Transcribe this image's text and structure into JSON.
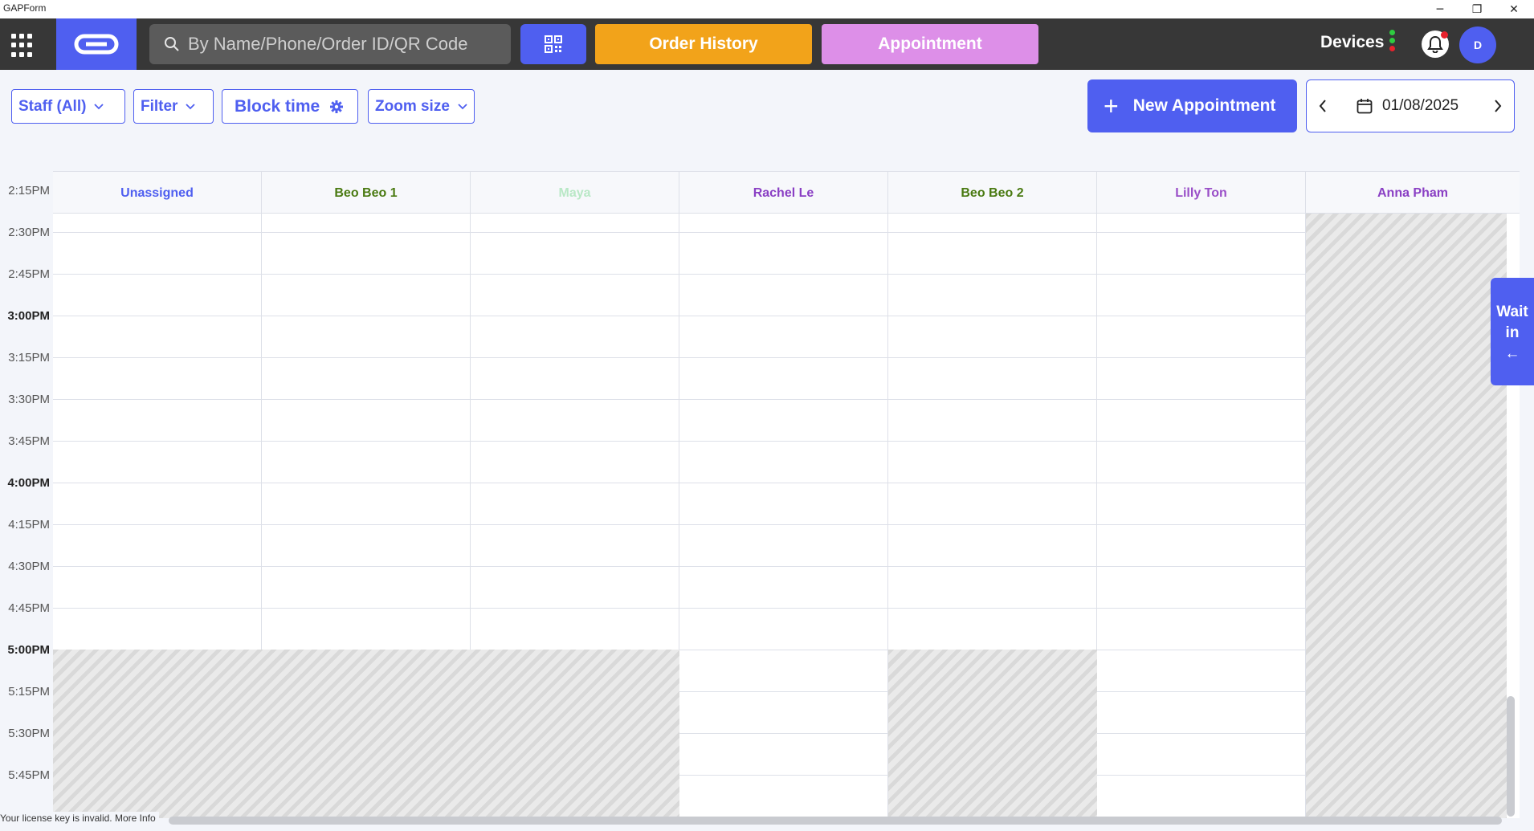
{
  "window": {
    "title": "GAPForm"
  },
  "topnav": {
    "search_placeholder": "By Name/Phone/Order ID/QR Code",
    "order_history_label": "Order History",
    "appointment_label": "Appointment",
    "devices_label": "Devices",
    "avatar_initial": "D",
    "colors": {
      "bar": "#373737",
      "brand": "#4f5ff0",
      "order": "#f2a31a",
      "appointment": "#dd8fe8"
    }
  },
  "toolbar": {
    "staff_label": "Staff (All)",
    "filter_label": "Filter",
    "block_time_label": "Block time",
    "zoom_label": "Zoom size",
    "new_appointment_label": "New Appointment",
    "date": "01/08/2025"
  },
  "calendar": {
    "times": [
      "2:15PM",
      "2:30PM",
      "2:45PM",
      "3:00PM",
      "3:15PM",
      "3:30PM",
      "3:45PM",
      "4:00PM",
      "4:15PM",
      "4:30PM",
      "4:45PM",
      "5:00PM",
      "5:15PM",
      "5:30PM",
      "5:45PM"
    ],
    "staff": [
      {
        "name": "Unassigned",
        "color": "#4f5ff0"
      },
      {
        "name": "Beo Beo 1",
        "color": "#4a7a12"
      },
      {
        "name": "Maya",
        "color": "#b9e8c6"
      },
      {
        "name": "Rachel Le",
        "color": "#8a3fc4"
      },
      {
        "name": "Beo Beo 2",
        "color": "#4a7a12"
      },
      {
        "name": "Lilly Ton",
        "color": "#9a4fc8"
      },
      {
        "name": "Anna Pham",
        "color": "#8a3fc4"
      }
    ]
  },
  "wait_panel": {
    "line1": "Wait",
    "line2": "in",
    "arrow": "←"
  },
  "license_text": "Your license key is invalid. More Info"
}
